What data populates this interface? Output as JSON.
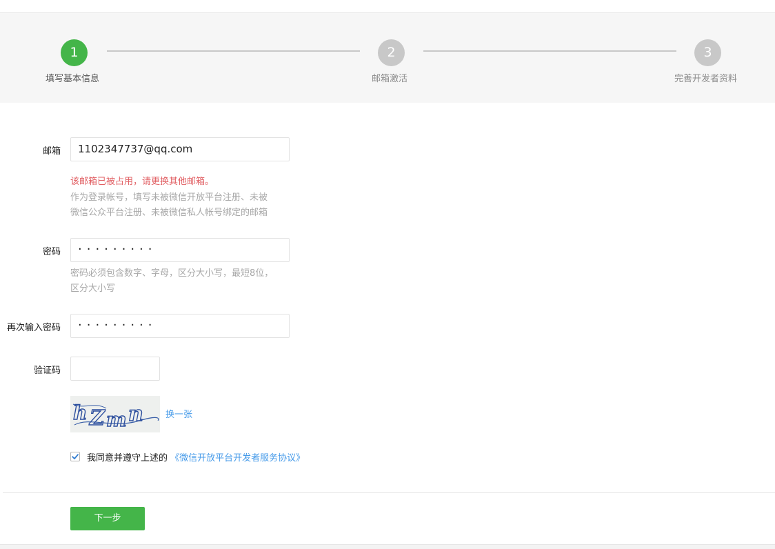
{
  "steps": [
    {
      "number": "1",
      "label": "填写基本信息",
      "state": "active"
    },
    {
      "number": "2",
      "label": "邮箱激活",
      "state": "inactive"
    },
    {
      "number": "3",
      "label": "完善开发者资料",
      "state": "inactive"
    }
  ],
  "form": {
    "email": {
      "label": "邮箱",
      "value": "1102347737@qq.com",
      "error": "该邮箱已被占用，请更换其他邮箱。",
      "hint_line1": "作为登录帐号，填写未被微信开放平台注册、未被",
      "hint_line2": "微信公众平台注册、未被微信私人帐号绑定的邮箱"
    },
    "password": {
      "label": "密码",
      "value": "·········",
      "hint_line1": "密码必须包含数字、字母，区分大小写，最短8位，",
      "hint_line2": "区分大小写"
    },
    "confirm_password": {
      "label": "再次输入密码",
      "value": "·········"
    },
    "captcha": {
      "label": "验证码",
      "value": "",
      "image_text": "hZmn",
      "refresh_label": "换一张"
    },
    "agreement": {
      "checked": true,
      "prefix": "我同意并遵守上述的",
      "link": "《微信开放平台开发者服务协议》"
    },
    "next_button": "下一步"
  },
  "colors": {
    "accent_green": "#44b549",
    "inactive_gray": "#c8c8c8",
    "error_red": "#e15f63",
    "link_blue": "#459ae9",
    "hint_gray": "#a8a8a8"
  }
}
